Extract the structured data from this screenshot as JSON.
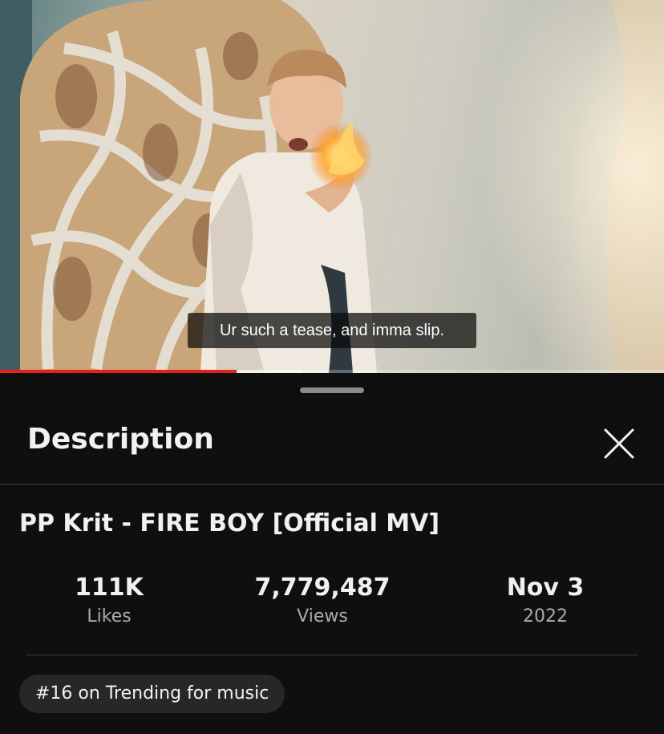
{
  "video": {
    "subtitle": "Ur such a tease, and imma slip.",
    "progress_played": 0.356,
    "progress_buffered": 0.455,
    "progress_color": "#e62117"
  },
  "sheet": {
    "title": "Description",
    "close_icon": "close-icon"
  },
  "details": {
    "video_title": "PP Krit - FIRE BOY [Official MV]",
    "stats": {
      "likes_value": "111K",
      "likes_label": "Likes",
      "views_value": "7,779,487",
      "views_label": "Views",
      "date_value": "Nov 3",
      "date_year": "2022"
    },
    "trending_chip": "#16 on Trending for music"
  }
}
